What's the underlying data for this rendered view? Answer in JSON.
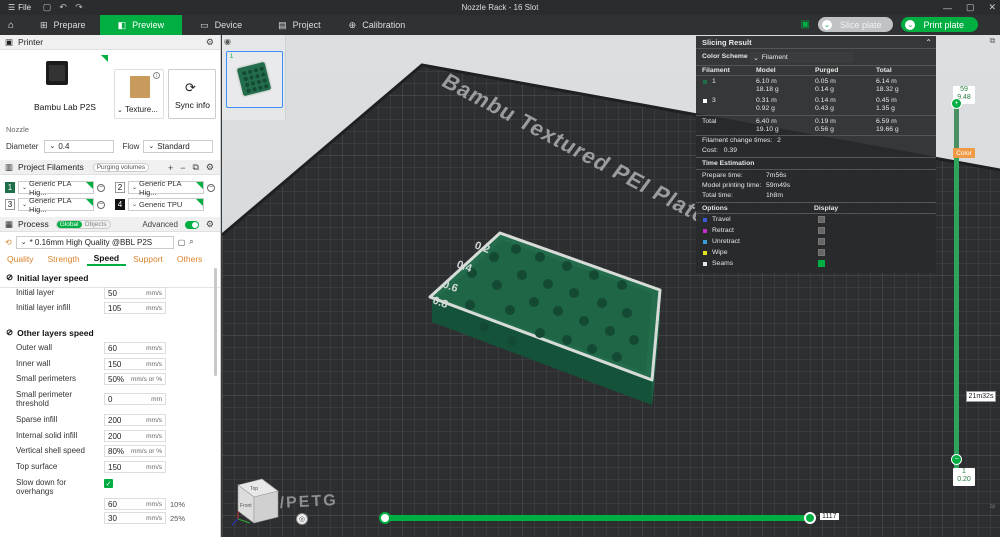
{
  "window": {
    "menu_label": "File",
    "title": "Nozzle Rack - 16 Slot"
  },
  "nav": {
    "tabs": [
      {
        "label": "Prepare",
        "icon": "prepare-icon"
      },
      {
        "label": "Preview",
        "icon": "preview-icon"
      },
      {
        "label": "Device",
        "icon": "device-icon"
      },
      {
        "label": "Project",
        "icon": "project-icon"
      },
      {
        "label": "Calibration",
        "icon": "calibration-icon"
      }
    ],
    "active_tab": "Preview",
    "slice_label": "Slice plate",
    "print_label": "Print plate"
  },
  "printer": {
    "section_title": "Printer",
    "printer_name": "Bambu Lab P2S",
    "plate_label": "Texture...",
    "sync_label": "Sync info",
    "nozzle_label": "Nozzle",
    "diameter_label": "Diameter",
    "diameter_value": "0.4",
    "flow_label": "Flow",
    "flow_value": "Standard"
  },
  "filaments": {
    "section_title": "Project Filaments",
    "purging_label": "Purging volumes",
    "items": [
      {
        "num": "1",
        "name": "Generic PLA Hig...",
        "color": "#1e6e4a"
      },
      {
        "num": "2",
        "name": "Generic PLA Hig...",
        "color": "#ffffff"
      },
      {
        "num": "3",
        "name": "Generic PLA Hig...",
        "color": "#ffffff"
      },
      {
        "num": "4",
        "name": "Generic TPU",
        "color": "#111111"
      }
    ]
  },
  "process": {
    "section_title": "Process",
    "toggle_global": "Global",
    "toggle_objects": "Objects",
    "advanced_label": "Advanced",
    "preset": "* 0.16mm High Quality @BBL P2S",
    "tabs": [
      "Quality",
      "Strength",
      "Speed",
      "Support",
      "Others"
    ],
    "active_tab": "Speed",
    "group_initial": "Initial layer speed",
    "initial_layer_label": "Initial layer",
    "initial_layer_value": "50",
    "initial_infill_label": "Initial layer infill",
    "initial_infill_value": "105",
    "group_other": "Other layers speed",
    "outer_wall_label": "Outer wall",
    "outer_wall_value": "60",
    "inner_wall_label": "Inner wall",
    "inner_wall_value": "150",
    "small_perim_label": "Small perimeters",
    "small_perim_value": "50%",
    "small_perim_thresh_label_1": "Small perimeter",
    "small_perim_thresh_label_2": "threshold",
    "small_perim_thresh_value": "0",
    "sparse_infill_label": "Sparse infill",
    "sparse_infill_value": "200",
    "internal_solid_label": "Internal solid infill",
    "internal_solid_value": "200",
    "vertical_shell_label": "Vertical shell speed",
    "vertical_shell_value": "80%",
    "top_surface_label": "Top surface",
    "top_surface_value": "150",
    "slow_overhang_label_1": "Slow down for",
    "slow_overhang_label_2": "overhangs",
    "overhang_1_value": "60",
    "overhang_1_pct": "10%",
    "overhang_2_value": "30",
    "overhang_2_pct": "25%",
    "unit_mms": "mm/s",
    "unit_mms_pct": "mm/s or %",
    "unit_mm": "mm"
  },
  "slicing": {
    "title": "Slicing Result",
    "color_scheme_label": "Color Scheme",
    "color_scheme_value": "Filament",
    "headers": [
      "Filament",
      "Model",
      "Purged",
      "Total"
    ],
    "rows": [
      {
        "id": "1",
        "swatch": "#1e6e4a",
        "model_m": "6.10 m",
        "model_g": "18.18 g",
        "purged_m": "0.05 m",
        "purged_g": "0.14 g",
        "total_m": "6.14 m",
        "total_g": "18.32 g"
      },
      {
        "id": "3",
        "swatch": "#ffffff",
        "model_m": "0.31 m",
        "model_g": "0.92 g",
        "purged_m": "0.14 m",
        "purged_g": "0.43 g",
        "total_m": "0.45 m",
        "total_g": "1.35 g"
      }
    ],
    "total_label": "Total",
    "total_model_m": "6.40 m",
    "total_model_g": "19.10 g",
    "total_purged_m": "0.19 m",
    "total_purged_g": "0.56 g",
    "total_total_m": "6.59 m",
    "total_total_g": "19.66 g",
    "change_times_label": "Filament change times:",
    "change_times_value": "2",
    "cost_label": "Cost:",
    "cost_value": "0.39",
    "time_title": "Time Estimation",
    "prepare_label": "Prepare time:",
    "prepare_value": "7m56s",
    "model_time_label": "Model printing time:",
    "model_time_value": "59m49s",
    "total_time_label": "Total time:",
    "total_time_value": "1h8m",
    "options_label": "Options",
    "display_label": "Display",
    "options": [
      {
        "label": "Travel",
        "color": "#3b5bd6",
        "on": false
      },
      {
        "label": "Retract",
        "color": "#c42ec4",
        "on": false
      },
      {
        "label": "Unretract",
        "color": "#3aa0d8",
        "on": false
      },
      {
        "label": "Wipe",
        "color": "#e8e020",
        "on": false
      },
      {
        "label": "Seams",
        "color": "#e8e8e8",
        "on": true
      }
    ]
  },
  "layers": {
    "top_layer": "59",
    "top_height": "9.48",
    "bottom_layer": "1",
    "bottom_height": "0.20",
    "color_btn": "Color",
    "time_tag": "21m32s",
    "move_value": "1117"
  },
  "viewport": {
    "plate_text": "Bambu Textured PEI Plate",
    "plate_bottom_text": "PLA/PETG",
    "cube_top": "Top",
    "cube_front": "Front"
  }
}
